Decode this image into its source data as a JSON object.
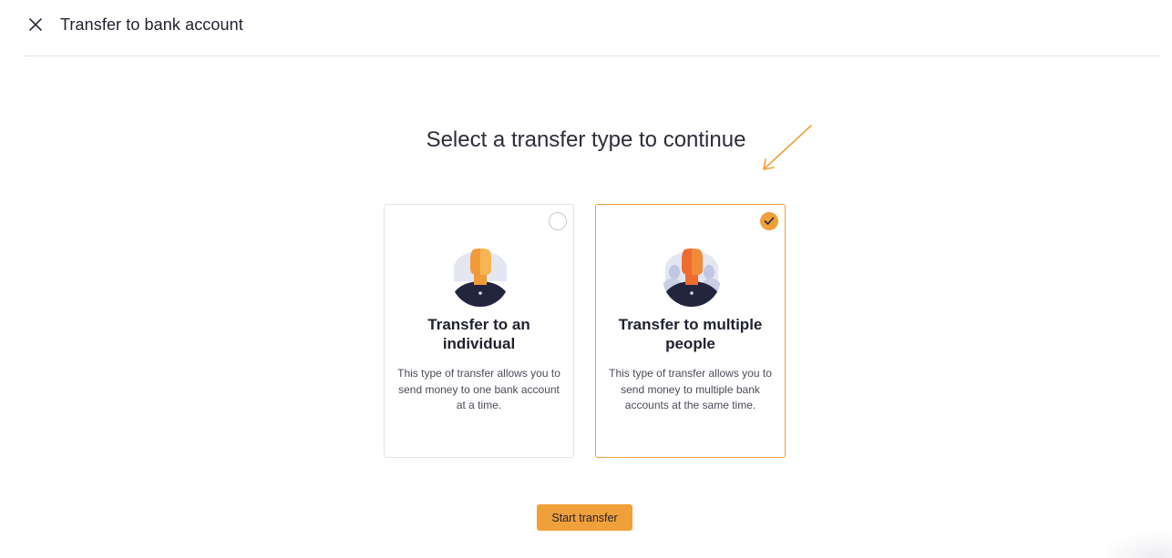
{
  "header": {
    "title": "Transfer to bank account",
    "close_icon": "close-icon"
  },
  "main": {
    "heading": "Select a transfer type to continue",
    "options": [
      {
        "title": "Transfer to an individual",
        "description": "This type of transfer allows you to send money to one bank account at a time.",
        "selected": false,
        "icon": "individual-avatar-icon"
      },
      {
        "title": "Transfer to multiple people",
        "description": "This type of transfer allows you to send money to multiple bank accounts at the same time.",
        "selected": true,
        "icon": "group-avatar-icon"
      }
    ],
    "start_label": "Start transfer"
  },
  "colors": {
    "accent": "#f0a03a",
    "avatar_dark": "#23253f",
    "avatar_orange": "#ef6c2f",
    "avatar_light_orange": "#f2993a",
    "avatar_lavender": "#c9cde6"
  }
}
